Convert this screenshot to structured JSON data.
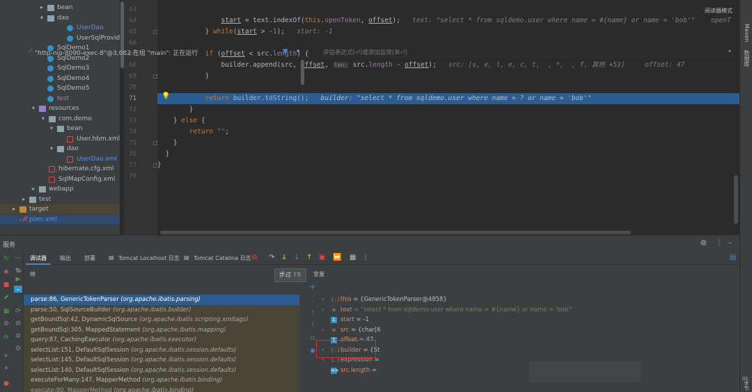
{
  "project_tree": [
    {
      "indent": 68,
      "arrow": "▸",
      "icon": "folder",
      "label": "bean",
      "style": ""
    },
    {
      "indent": 68,
      "arrow": "▾",
      "icon": "folder",
      "label": "dao",
      "style": ""
    },
    {
      "indent": 96,
      "arrow": "",
      "icon": "cls",
      "label": "UserDao",
      "style": "blue"
    },
    {
      "indent": 96,
      "arrow": "",
      "icon": "cls",
      "label": "UserSqlProvide",
      "style": ""
    },
    {
      "indent": 68,
      "arrow": "",
      "icon": "cls",
      "label": "SqlDemo1",
      "style": ""
    },
    {
      "indent": 68,
      "arrow": "",
      "icon": "cls",
      "label": "SqlDemo2",
      "style": ""
    },
    {
      "indent": 68,
      "arrow": "",
      "icon": "cls",
      "label": "SqlDemo3",
      "style": ""
    },
    {
      "indent": 68,
      "arrow": "",
      "icon": "cls",
      "label": "SqlDemo4",
      "style": ""
    },
    {
      "indent": 68,
      "arrow": "",
      "icon": "cls",
      "label": "SqlDemo5",
      "style": ""
    },
    {
      "indent": 68,
      "arrow": "",
      "icon": "cls",
      "label": "test",
      "style": "red"
    },
    {
      "indent": 56,
      "arrow": "▾",
      "icon": "resfolder",
      "label": "resources",
      "style": ""
    },
    {
      "indent": 70,
      "arrow": "▾",
      "icon": "folder",
      "label": "com.demo",
      "style": ""
    },
    {
      "indent": 82,
      "arrow": "▾",
      "icon": "folder",
      "label": "bean",
      "style": ""
    },
    {
      "indent": 96,
      "arrow": "",
      "icon": "xml",
      "label": "User.hbm.xml",
      "style": ""
    },
    {
      "indent": 82,
      "arrow": "▾",
      "icon": "folder",
      "label": "dao",
      "style": ""
    },
    {
      "indent": 96,
      "arrow": "",
      "icon": "xml",
      "label": "UserDao.xml",
      "style": "blue"
    },
    {
      "indent": 70,
      "arrow": "",
      "icon": "cfg",
      "label": "hibernate.cfg.xml",
      "style": ""
    },
    {
      "indent": 70,
      "arrow": "",
      "icon": "cfg",
      "label": "SqlMapConfig.xml",
      "style": ""
    },
    {
      "indent": 56,
      "arrow": "▸",
      "icon": "folder",
      "label": "webapp",
      "style": ""
    },
    {
      "indent": 42,
      "arrow": "▸",
      "icon": "folder",
      "label": "test",
      "style": ""
    },
    {
      "indent": 28,
      "arrow": "▸",
      "icon": "target",
      "label": "target",
      "style": "target"
    },
    {
      "indent": 28,
      "arrow": "",
      "icon": "maven",
      "label": "pom.xml",
      "style": "sel"
    }
  ],
  "editor": {
    "reader_mode": "阅读器模式",
    "lines": [
      {
        "n": "63",
        "html": ""
      },
      {
        "n": "64",
        "html": "                <span class=\"uvar\">start</span> = text.indexOf(<span class=\"kw\">this</span>.<span class=\"fld\">openToken</span>, <span class=\"uvar\">offset</span>);   <span class=\"hint\">text: \"select * from sqldemo.user where name = #{name} or name = 'bob'\"    openT</span>"
      },
      {
        "n": "65",
        "html": "            } <span class=\"kw\">while</span>(<span class=\"uvar\">start</span> > -<span class=\"fld\">1</span>);   <span class=\"hint\">start: -1</span>"
      },
      {
        "n": "66",
        "html": ""
      },
      {
        "n": "67",
        "html": "            <span class=\"kw\">if</span> (<span class=\"uvar\">offset</span> < src.<span class=\"fld\">length</span>) {"
      },
      {
        "n": "68",
        "html": "                builder.append(src, <span class=\"uvar\">offset</span>, <span class=\"param-hint\">len:</span> src.<span class=\"fld\">length</span> - <span class=\"uvar\">offset</span>);   <span class=\"hint\">src: [s, e, l, e, c, t,  , *,  , f, 其他 +53]     offset: 47</span>"
      },
      {
        "n": "69",
        "html": "            }"
      },
      {
        "n": "70",
        "html": ""
      },
      {
        "n": "71",
        "html": "            <span class=\"kw\">return</span> builder.toString();   <span class=\"hint-cur\">builder: \"select * from sqldemo.user where name = ? or name = 'bob'\"</span>",
        "current": true
      },
      {
        "n": "72",
        "html": "        }"
      },
      {
        "n": "73",
        "html": "    } <span class=\"kw\">else</span> {"
      },
      {
        "n": "74",
        "html": "        <span class=\"kw\">return</span> <span class=\"str\">\"\"</span>;"
      },
      {
        "n": "75",
        "html": "    }"
      },
      {
        "n": "76",
        "html": "  }"
      },
      {
        "n": "77",
        "html": "}"
      },
      {
        "n": "78",
        "html": ""
      }
    ]
  },
  "right_strip": {
    "maven": "Maven",
    "database": "数据库",
    "bottom": "01",
    "bottom2": "字节"
  },
  "services": {
    "title": "服务",
    "tabs": [
      "调试器",
      "输出",
      "部署",
      "Tomcat Localhost 日志",
      "Tomcat Catalina 日志"
    ],
    "frames_label": "帧",
    "variables_label": "变量",
    "thread": "\"http-nio-8090-exec-8\"@3,082 在组 \"main\": 正在运行",
    "tooltip": {
      "label": "步过",
      "key": "F8"
    },
    "to_label": "To",
    "frames": [
      {
        "method": "parse:86, GenericTokenParser",
        "cls": "(org.apache.ibatis.parsing)",
        "sel": true
      },
      {
        "method": "parse:50, SqlSourceBuilder",
        "cls": "(org.apache.ibatis.builder)",
        "sel": false
      },
      {
        "method": "getBoundSql:42, DynamicSqlSource",
        "cls": "(org.apache.ibatis.scripting.xmltags)",
        "sel": false
      },
      {
        "method": "getBoundSql:305, MappedStatement",
        "cls": "(org.apache.ibatis.mapping)",
        "sel": false
      },
      {
        "method": "query:87, CachingExecutor",
        "cls": "(org.apache.ibatis.executor)",
        "sel": false
      },
      {
        "method": "selectList:151, DefaultSqlSession",
        "cls": "(org.apache.ibatis.session.defaults)",
        "sel": false
      },
      {
        "method": "selectList:145, DefaultSqlSession",
        "cls": "(org.apache.ibatis.session.defaults)",
        "sel": false
      },
      {
        "method": "selectList:140, DefaultSqlSession",
        "cls": "(org.apache.ibatis.session.defaults)",
        "sel": false
      },
      {
        "method": "executeForMany:147, MapperMethod",
        "cls": "(org.apache.ibatis.binding)",
        "sel": false
      },
      {
        "method": "execute:80, MapperMethod",
        "cls": "(org.apache.ibatis.binding)",
        "sel": false
      }
    ],
    "eval_placeholder": "评估表达式(⏎)或添加监视(⌘⏎)",
    "variables": [
      {
        "expand": "›",
        "icon": "obj",
        "glyph": "{..}",
        "name": "this",
        "value": " = {GenericTokenParser@4858}",
        "str": false
      },
      {
        "expand": "›",
        "icon": "arr",
        "glyph": "≡",
        "name": "text",
        "value": " = \"select * from sqldemo.user where name = #{name} or name = 'bob'\"",
        "str": true
      },
      {
        "expand": "",
        "icon": "prim",
        "glyph": "1",
        "name": "start",
        "value": " = -1",
        "str": false
      },
      {
        "expand": "›",
        "icon": "arr",
        "glyph": "≡",
        "name": "src",
        "value": " = {char[6",
        "str": false
      },
      {
        "expand": "",
        "icon": "prim",
        "glyph": "1",
        "name": "offset",
        "value": " = 47",
        "str": false
      },
      {
        "expand": "›",
        "icon": "obj",
        "glyph": "{..}",
        "name": "builder",
        "value": " = {St",
        "str": false
      },
      {
        "expand": "›",
        "icon": "obj",
        "glyph": "{..}",
        "name": "expression",
        "value": " =",
        "str": false
      },
      {
        "expand": "",
        "icon": "prim",
        "glyph": "∞∞",
        "name": "src.length",
        "value": " =",
        "str": false
      }
    ]
  }
}
